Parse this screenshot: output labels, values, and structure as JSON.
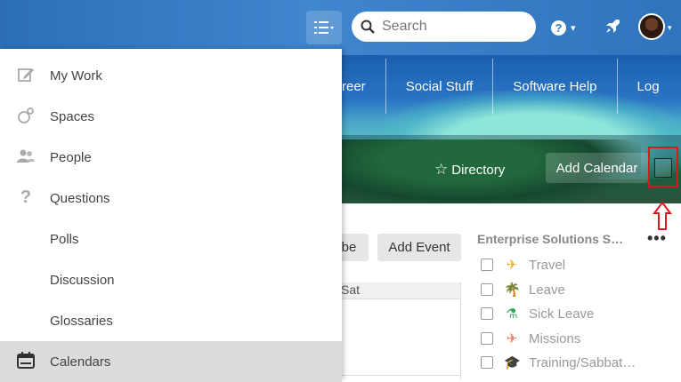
{
  "topbar": {
    "search_placeholder": "Search",
    "help_glyph": "?",
    "caret": "▾"
  },
  "banner": {
    "nav_links": [
      "reer",
      "Social Stuff",
      "Software Help",
      "Log"
    ],
    "directory_label": "Directory",
    "add_calendar_label": "Add Calendar"
  },
  "menu": {
    "items": [
      {
        "label": "My Work",
        "icon": "pencil-square-icon"
      },
      {
        "label": "Spaces",
        "icon": "spaces-icon"
      },
      {
        "label": "People",
        "icon": "people-icon"
      },
      {
        "label": "Questions",
        "icon": "question-icon"
      },
      {
        "label": "Polls",
        "icon": "poll-icon"
      },
      {
        "label": "Discussion",
        "icon": "discussion-icon"
      },
      {
        "label": "Glossaries",
        "icon": "glossary-icon"
      },
      {
        "label": "Calendars",
        "icon": "calendar-icon",
        "selected": true
      }
    ]
  },
  "content": {
    "subscribe_label": "be",
    "add_event_label": "Add Event",
    "grid_header": "Sat",
    "calendar_list_title": "Enterprise Solutions S…",
    "kebab": "•••",
    "calendars": [
      {
        "name": "Travel",
        "icon": "plane-icon",
        "color": "#f2b01e",
        "glyph": "✈"
      },
      {
        "name": "Leave",
        "icon": "palm-tree-icon",
        "color": "#f47c5a",
        "glyph": "🌴"
      },
      {
        "name": "Sick Leave",
        "icon": "flask-icon",
        "color": "#3aa55b",
        "glyph": "⚗"
      },
      {
        "name": "Missions",
        "icon": "plane-icon",
        "color": "#f47c5a",
        "glyph": "✈"
      },
      {
        "name": "Training/Sabbat…",
        "icon": "graduation-cap-icon",
        "color": "#3d8fd6",
        "glyph": "🎓"
      }
    ]
  },
  "colors": {
    "topbar": "#3a80c9",
    "highlight_box": "#e0141e",
    "selected_menu": "#dcdcdc"
  }
}
